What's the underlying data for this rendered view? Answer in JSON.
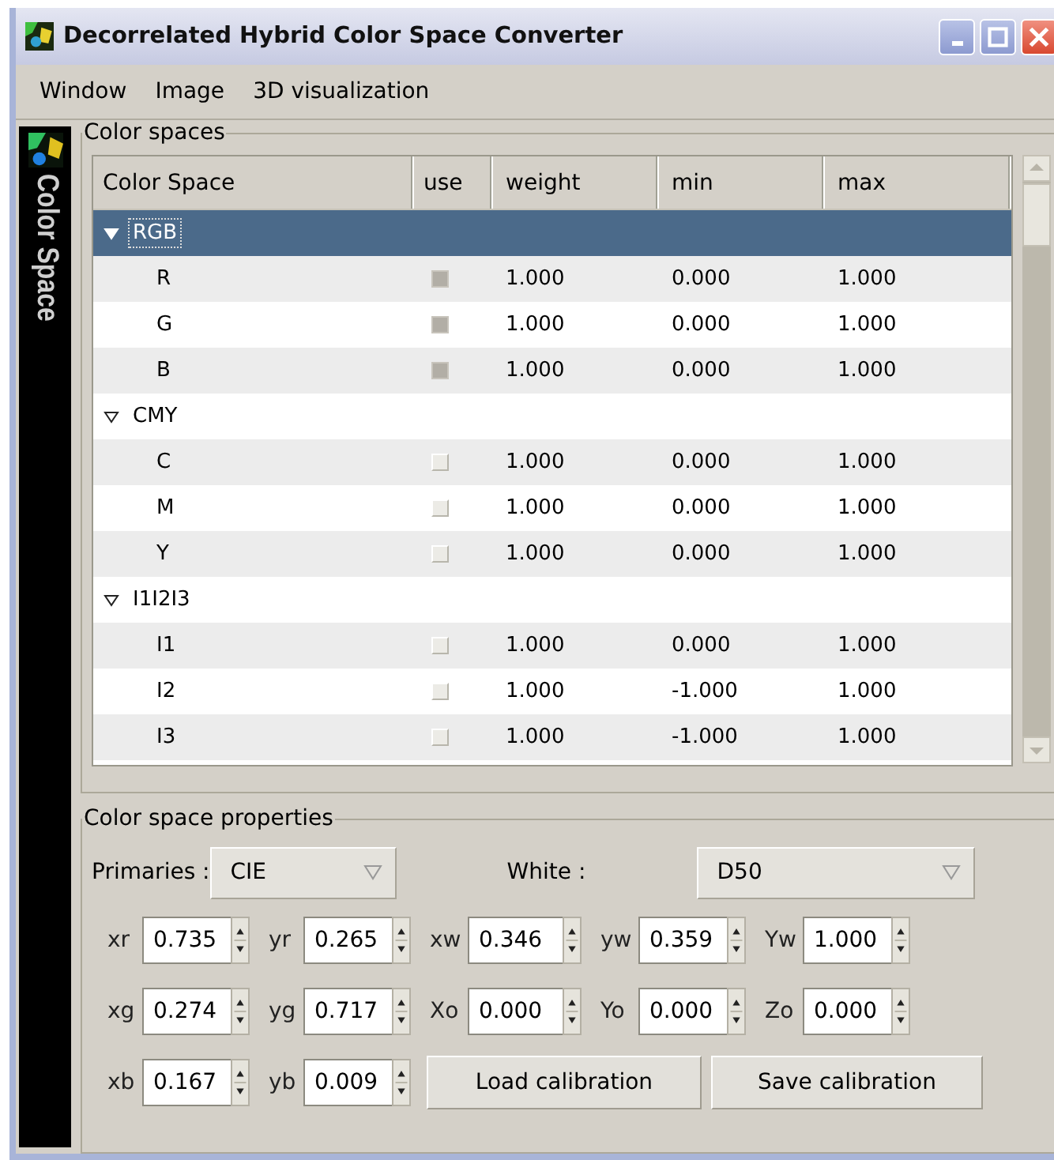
{
  "window": {
    "title": "Decorrelated Hybrid Color Space Converter"
  },
  "menu": [
    "Window",
    "Image",
    "3D visualization"
  ],
  "side_tab": {
    "label": "Color Space"
  },
  "color_spaces": {
    "title": "Color spaces",
    "columns": [
      "Color Space",
      "use",
      "weight",
      "min",
      "max"
    ],
    "groups": [
      {
        "name": "RGB",
        "expanded": true,
        "selected": true,
        "children": [
          {
            "name": "R",
            "use": true,
            "weight": "1.000",
            "min": "0.000",
            "max": "1.000"
          },
          {
            "name": "G",
            "use": true,
            "weight": "1.000",
            "min": "0.000",
            "max": "1.000"
          },
          {
            "name": "B",
            "use": true,
            "weight": "1.000",
            "min": "0.000",
            "max": "1.000"
          }
        ]
      },
      {
        "name": "CMY",
        "expanded": true,
        "selected": false,
        "children": [
          {
            "name": "C",
            "use": false,
            "weight": "1.000",
            "min": "0.000",
            "max": "1.000"
          },
          {
            "name": "M",
            "use": false,
            "weight": "1.000",
            "min": "0.000",
            "max": "1.000"
          },
          {
            "name": "Y",
            "use": false,
            "weight": "1.000",
            "min": "0.000",
            "max": "1.000"
          }
        ]
      },
      {
        "name": "I1I2I3",
        "expanded": true,
        "selected": false,
        "children": [
          {
            "name": "I1",
            "use": false,
            "weight": "1.000",
            "min": "0.000",
            "max": "1.000"
          },
          {
            "name": "I2",
            "use": false,
            "weight": "1.000",
            "min": "-1.000",
            "max": "1.000"
          },
          {
            "name": "I3",
            "use": false,
            "weight": "1.000",
            "min": "-1.000",
            "max": "1.000"
          }
        ]
      }
    ]
  },
  "properties": {
    "title": "Color space properties",
    "primaries": {
      "label": "Primaries :",
      "value": "CIE"
    },
    "white": {
      "label": "White :",
      "value": "D50"
    },
    "spin_rows": [
      [
        {
          "label": "xr",
          "value": "0.735"
        },
        {
          "label": "yr",
          "value": "0.265"
        },
        {
          "label": "xw",
          "value": "0.346"
        },
        {
          "label": "yw",
          "value": "0.359"
        },
        {
          "label": "Yw",
          "value": "1.000"
        }
      ],
      [
        {
          "label": "xg",
          "value": "0.274"
        },
        {
          "label": "yg",
          "value": "0.717"
        },
        {
          "label": "Xo",
          "value": "0.000"
        },
        {
          "label": "Yo",
          "value": "0.000"
        },
        {
          "label": "Zo",
          "value": "0.000"
        }
      ],
      [
        {
          "label": "xb",
          "value": "0.167"
        },
        {
          "label": "yb",
          "value": "0.009"
        }
      ]
    ],
    "buttons": [
      "Load calibration",
      "Save calibration"
    ]
  }
}
